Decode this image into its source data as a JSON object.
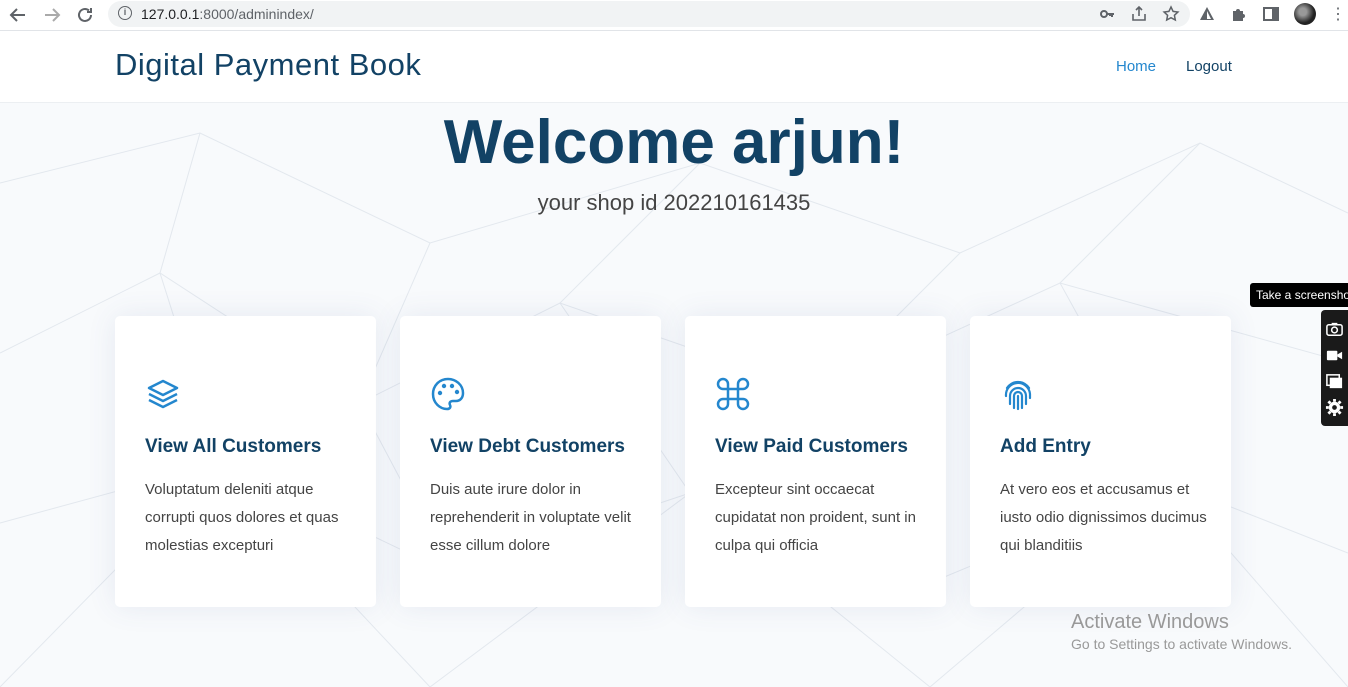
{
  "browser": {
    "url_host": "127.0.0.1",
    "url_rest": ":8000/adminindex/"
  },
  "header": {
    "logo": "Digital Payment Book",
    "nav": [
      {
        "label": "Home",
        "active": true
      },
      {
        "label": "Logout",
        "active": false
      }
    ]
  },
  "hero": {
    "title": "Welcome arjun!",
    "subtitle": "your shop id 202210161435"
  },
  "cards": [
    {
      "icon": "layers-icon",
      "title": "View All Customers",
      "desc": "Voluptatum deleniti atque corrupti quos dolores et quas molestias excepturi"
    },
    {
      "icon": "palette-icon",
      "title": "View Debt Customers",
      "desc": "Duis aute irure dolor in reprehenderit in voluptate velit esse cillum dolore"
    },
    {
      "icon": "command-icon",
      "title": "View Paid Customers",
      "desc": "Excepteur sint occaecat cupidatat non proident, sunt in culpa qui officia"
    },
    {
      "icon": "fingerprint-icon",
      "title": "Add Entry",
      "desc": "At vero eos et accusamus et iusto odio dignissimos ducimus qui blanditiis"
    }
  ],
  "overlay": {
    "tooltip": "Take a screenshot",
    "activate_title": "Activate Windows",
    "activate_sub": "Go to Settings to activate Windows."
  },
  "colors": {
    "primary": "#124265",
    "accent": "#2487ce",
    "text": "#444444"
  }
}
